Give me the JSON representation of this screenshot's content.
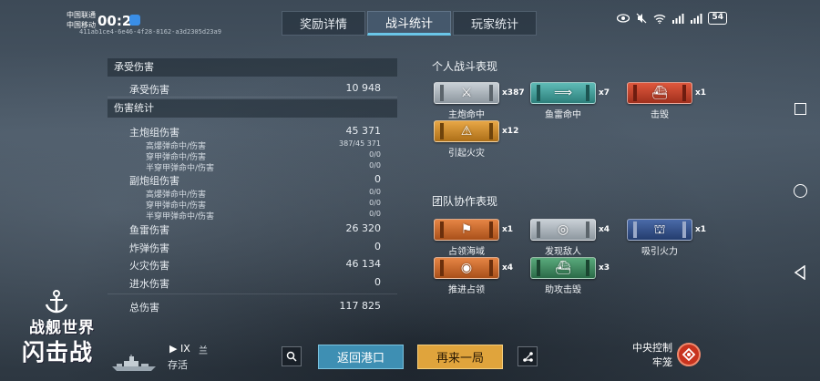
{
  "status_bar": {
    "carrier_line1": "中国联通",
    "carrier_line2": "中国移动",
    "time": "00:28",
    "session_id": "411ab1ce4-6e46-4f28-8162-a3d2305d23a9",
    "battery": "54"
  },
  "tabs": [
    {
      "label": "奖励详情",
      "active": false
    },
    {
      "label": "战斗统计",
      "active": true
    },
    {
      "label": "玩家统计",
      "active": false
    }
  ],
  "damage": {
    "received_header": "承受伤害",
    "received_label": "承受伤害",
    "received_value": "10 948",
    "stats_header": "伤害统计",
    "main_battery": {
      "label": "主炮组伤害",
      "value": "45 371"
    },
    "main_sub": [
      {
        "label": "高爆弹命中/伤害",
        "value": "387/45 371"
      },
      {
        "label": "穿甲弹命中/伤害",
        "value": "0/0"
      },
      {
        "label": "半穿甲弹命中/伤害",
        "value": "0/0"
      }
    ],
    "secondary": {
      "label": "副炮组伤害",
      "value": "0"
    },
    "secondary_sub": [
      {
        "label": "高爆弹命中/伤害",
        "value": "0/0"
      },
      {
        "label": "穿甲弹命中/伤害",
        "value": "0/0"
      },
      {
        "label": "半穿甲弹命中/伤害",
        "value": "0/0"
      }
    ],
    "torpedo": {
      "label": "鱼雷伤害",
      "value": "26 320"
    },
    "bomb": {
      "label": "炸弹伤害",
      "value": "0"
    },
    "fire": {
      "label": "火灾伤害",
      "value": "46 134"
    },
    "flooding": {
      "label": "进水伤害",
      "value": "0"
    },
    "total": {
      "label": "总伤害",
      "value": "117 825"
    }
  },
  "personal": {
    "title": "个人战斗表现",
    "ribbons": [
      {
        "label": "主炮命中",
        "count": "x387",
        "color": "silver",
        "icon": "crossed-guns-icon"
      },
      {
        "label": "鱼雷命中",
        "count": "x7",
        "color": "teal",
        "icon": "torpedo-icon"
      },
      {
        "label": "击毁",
        "count": "x1",
        "color": "red",
        "icon": "sinking-ship-icon"
      },
      {
        "label": "引起火灾",
        "count": "x12",
        "color": "gold",
        "icon": "fire-icon"
      }
    ]
  },
  "team": {
    "title": "团队协作表现",
    "ribbons": [
      {
        "label": "占领海域",
        "count": "x1",
        "color": "orange",
        "icon": "flag-icon"
      },
      {
        "label": "发现敌人",
        "count": "x4",
        "color": "silver",
        "icon": "radar-icon"
      },
      {
        "label": "吸引火力",
        "count": "x1",
        "color": "navy",
        "icon": "splash-icon"
      },
      {
        "label": "推进占领",
        "count": "x4",
        "color": "orange",
        "icon": "capture-icon"
      },
      {
        "label": "助攻击毁",
        "count": "x3",
        "color": "green",
        "icon": "assist-kill-icon"
      }
    ]
  },
  "logo": {
    "line1": "战舰世界",
    "line2": "闪击战"
  },
  "bottom": {
    "tier": "IX",
    "nation_icon": "兰",
    "status": "存活",
    "return_label": "返回港口",
    "again_label": "再来一局",
    "control_line1": "中央控制",
    "control_line2": "牢笼"
  },
  "colors": {
    "accent_blue": "#3e8fb3",
    "accent_gold": "#e0a43c",
    "tab_active_underline": "#6ac6e8"
  }
}
